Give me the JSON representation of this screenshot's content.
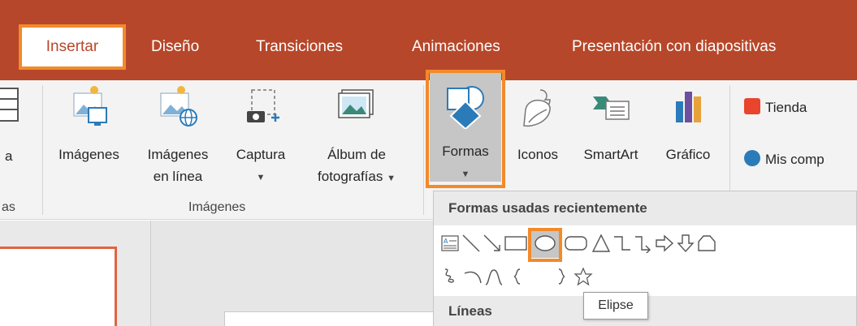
{
  "tabs": {
    "insertar": "Insertar",
    "diseno": "Diseño",
    "transiciones": "Transiciones",
    "animaciones": "Animaciones",
    "presentacion": "Presentación con diapositivas"
  },
  "ribbon": {
    "partial_left_label": "a",
    "partial_left_group": "as",
    "imagenes": "Imágenes",
    "imagenes_linea_1": "Imágenes",
    "imagenes_linea_2": "en línea",
    "captura": "Captura",
    "album_1": "Álbum de",
    "album_2": "fotografías",
    "group_imagenes": "Imágenes",
    "formas": "Formas",
    "iconos": "Iconos",
    "smartart": "SmartArt",
    "grafico": "Gráfico",
    "tienda": "Tienda",
    "mis_comp": "Mis comp"
  },
  "dropdown": {
    "header_recent": "Formas usadas recientemente",
    "header_lineas": "Líneas"
  },
  "tooltip": "Elipse",
  "colors": {
    "accent": "#b7472a",
    "highlight": "#f28a2a",
    "ribbon_bg": "#f3f3f3"
  }
}
